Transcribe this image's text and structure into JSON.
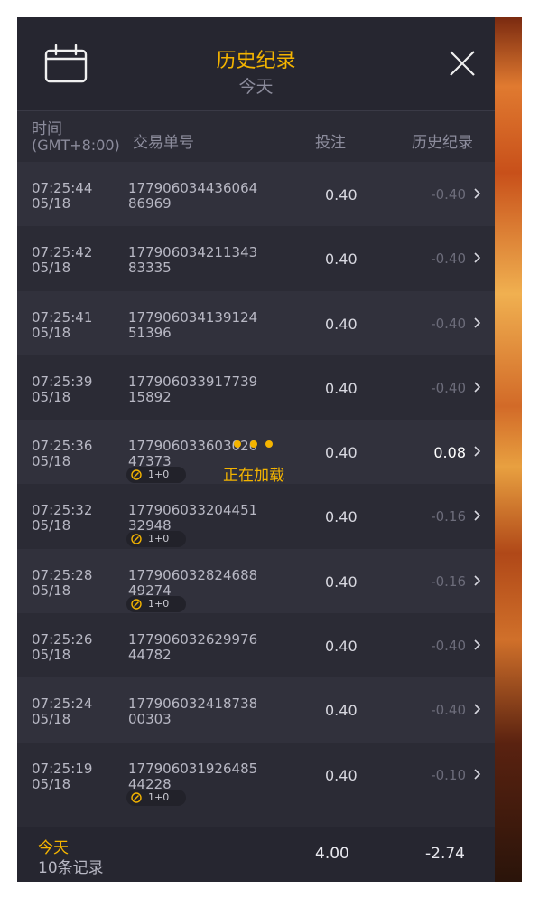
{
  "header": {
    "title": "历史纪录",
    "subtitle": "今天"
  },
  "columns": {
    "time": "时间",
    "timezone": "(GMT+8:00)",
    "order": "交易单号",
    "bet": "投注",
    "history": "历史纪录"
  },
  "rows": [
    {
      "time": "07:25:44",
      "date": "05/18",
      "order": "17790603443606486969",
      "bet": "0.40",
      "result": "-0.40",
      "badge": null,
      "positive": false
    },
    {
      "time": "07:25:42",
      "date": "05/18",
      "order": "17790603421134383335",
      "bet": "0.40",
      "result": "-0.40",
      "badge": null,
      "positive": false
    },
    {
      "time": "07:25:41",
      "date": "05/18",
      "order": "17790603413912451396",
      "bet": "0.40",
      "result": "-0.40",
      "badge": null,
      "positive": false
    },
    {
      "time": "07:25:39",
      "date": "05/18",
      "order": "17790603391773915892",
      "bet": "0.40",
      "result": "-0.40",
      "badge": null,
      "positive": false
    },
    {
      "time": "07:25:36",
      "date": "05/18",
      "order": "17790603360302047373",
      "bet": "0.40",
      "result": "0.08",
      "badge": "1+0",
      "positive": true
    },
    {
      "time": "07:25:32",
      "date": "05/18",
      "order": "17790603320445132948",
      "bet": "0.40",
      "result": "-0.16",
      "badge": "1+0",
      "positive": false
    },
    {
      "time": "07:25:28",
      "date": "05/18",
      "order": "17790603282468849274",
      "bet": "0.40",
      "result": "-0.16",
      "badge": "1+0",
      "positive": false
    },
    {
      "time": "07:25:26",
      "date": "05/18",
      "order": "17790603262997644782",
      "bet": "0.40",
      "result": "-0.40",
      "badge": null,
      "positive": false
    },
    {
      "time": "07:25:24",
      "date": "05/18",
      "order": "17790603241873800303",
      "bet": "0.40",
      "result": "-0.40",
      "badge": null,
      "positive": false
    },
    {
      "time": "07:25:19",
      "date": "05/18",
      "order": "17790603192648544228",
      "bet": "0.40",
      "result": "-0.10",
      "badge": "1+0",
      "positive": false
    }
  ],
  "loading": {
    "text": "正在加载"
  },
  "footer": {
    "today": "今天",
    "count": "10条记录",
    "total_bet": "4.00",
    "total_result": "-2.74"
  },
  "icons": {
    "header_left": "calendar-icon",
    "header_right": "close-icon",
    "row_arrow": "chevron-right-icon",
    "badge": "bonus-coin-icon"
  },
  "colors": {
    "accent": "#f4b400",
    "panel_bg": "#2b2b35",
    "row_alt": "#31313c",
    "muted": "#6c6c7a"
  }
}
